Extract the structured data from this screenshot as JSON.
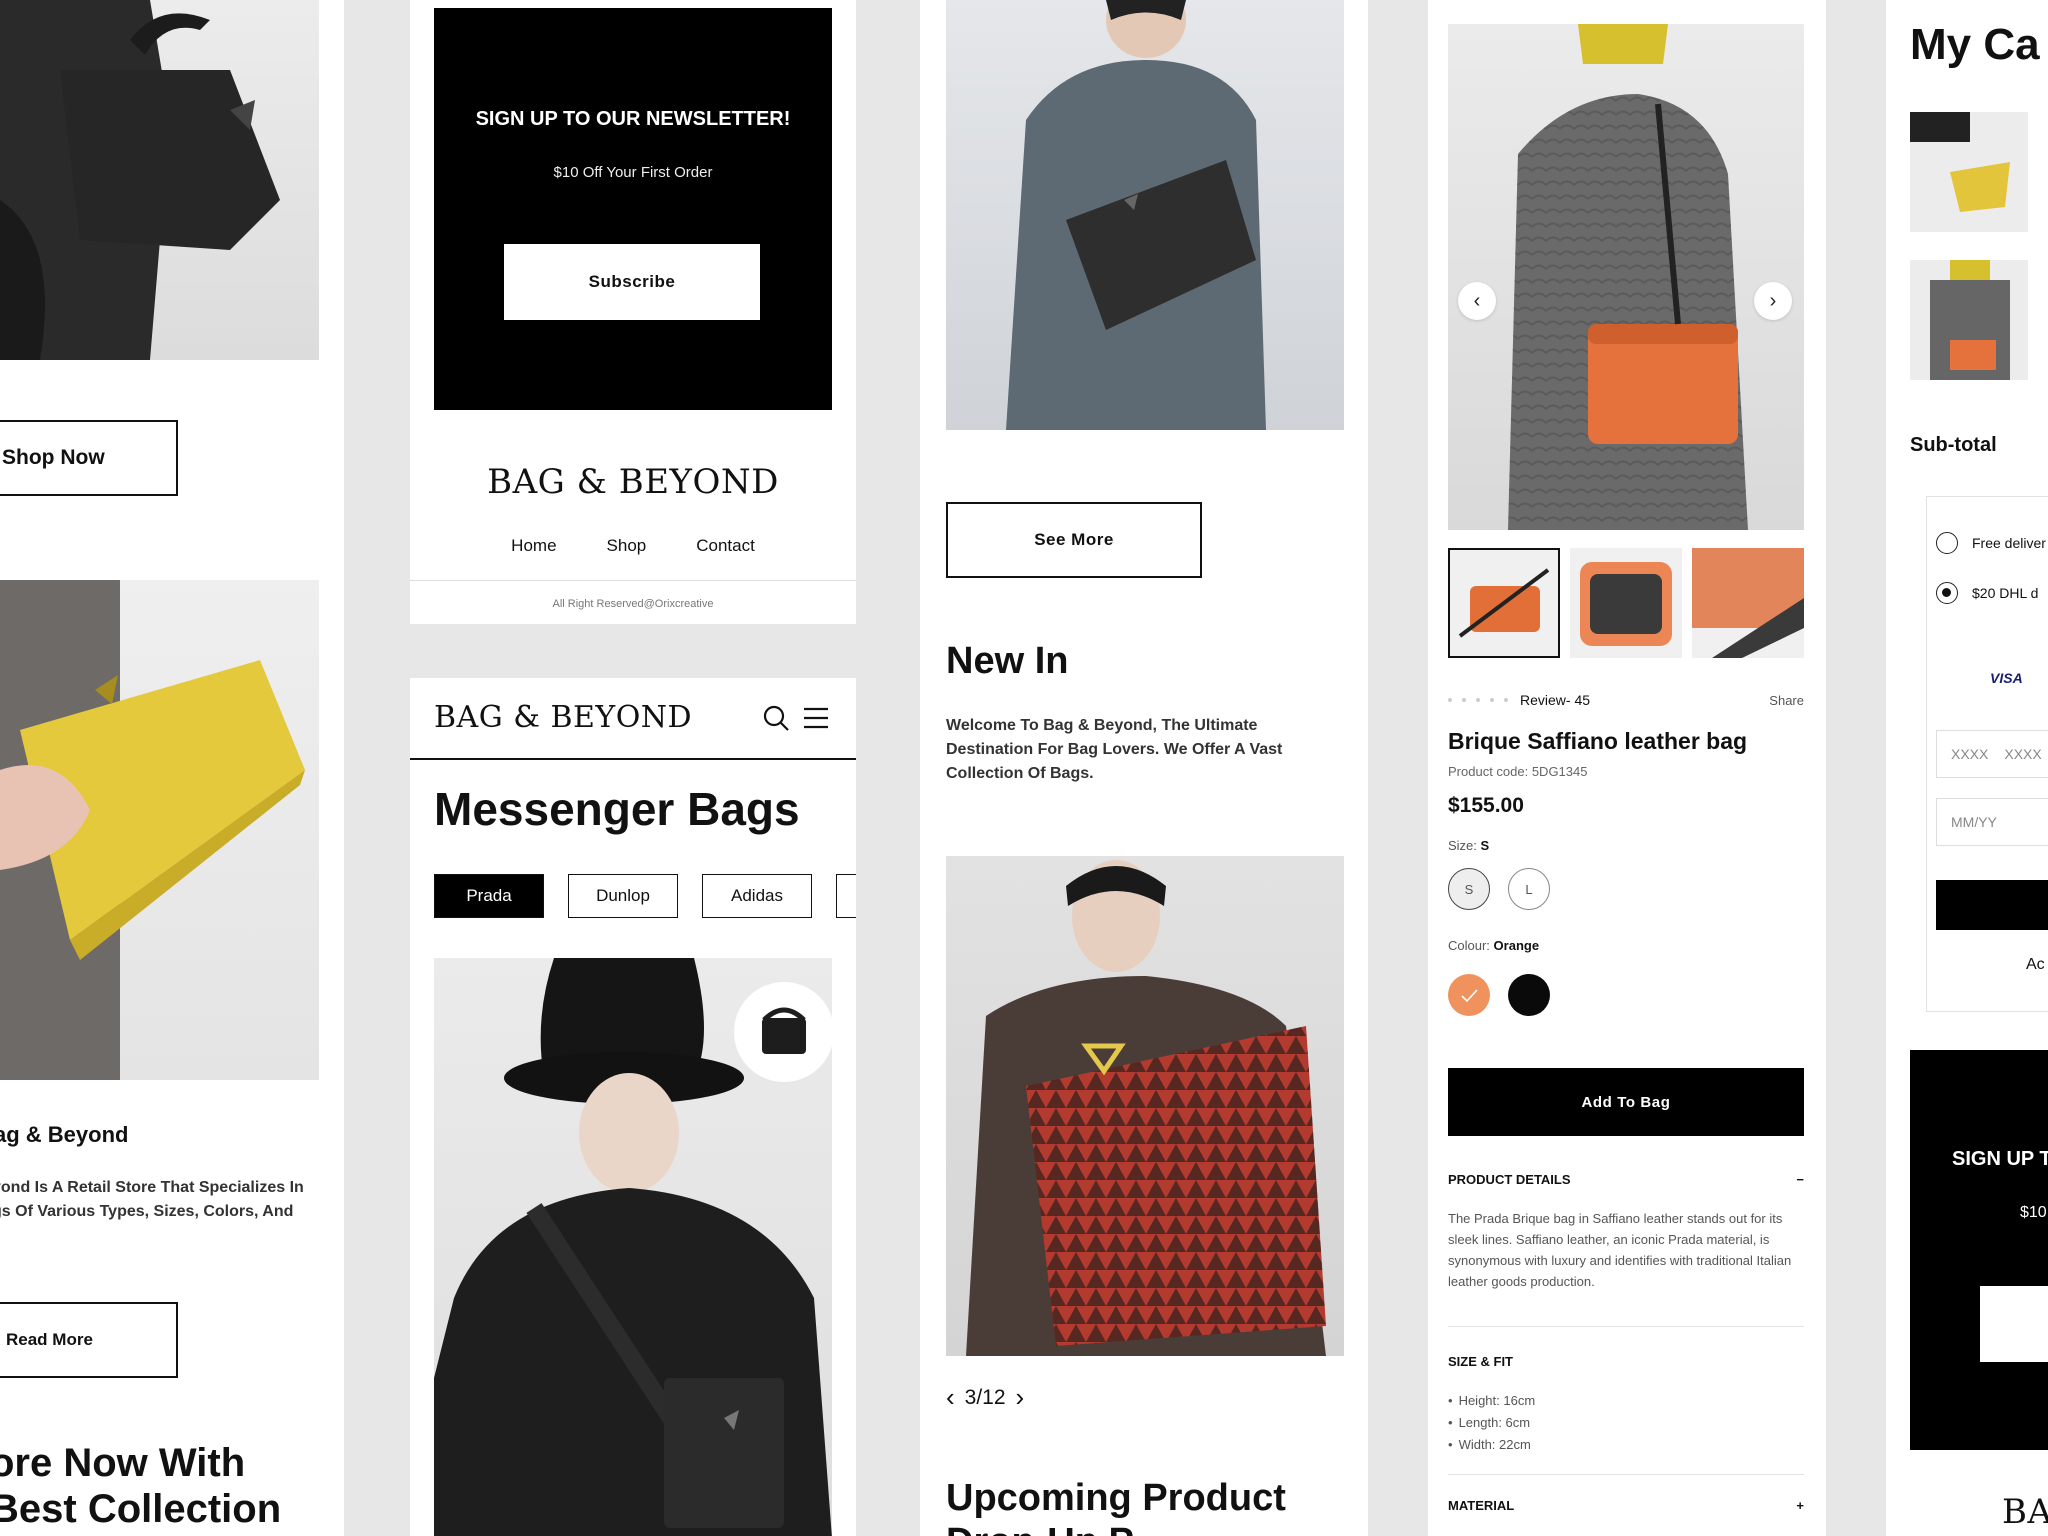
{
  "hero": {
    "shop_now": "Shop Now",
    "about_title": "ag & Beyond",
    "about_text": "yond Is A Retail Store That Specializes In gs Of Various Types, Sizes, Colors, And",
    "read_more": "Read More",
    "explore_title": "ore Now With Best Collection"
  },
  "newsletter": {
    "title": "SIGN UP TO OUR NEWSLETTER!",
    "subtitle": "$10 Off Your First Order",
    "button": "Subscribe"
  },
  "footer": {
    "logo": "BAG & BEYOND",
    "nav": [
      "Home",
      "Shop",
      "Contact"
    ],
    "copyright": "All Right Reserved@Orixcreative"
  },
  "category_page": {
    "logo": "BAG & BEYOND",
    "title": "Messenger Bags",
    "brands": [
      "Prada",
      "Dunlop",
      "Adidas"
    ]
  },
  "home": {
    "see_more": "See More",
    "new_in_title": "New In",
    "new_in_text": "Welcome To Bag & Beyond, The Ultimate Destination For Bag Lovers. We Offer A Vast Collection Of Bags.",
    "pager": "3/12",
    "upcoming_title": "Upcoming Product Drop-Up P"
  },
  "product": {
    "review": "Review- 45",
    "share": "Share",
    "name": "Brique Saffiano leather bag",
    "code": "Product code: 5DG1345",
    "price": "$155.00",
    "size_label": "Size:",
    "size_value": "S",
    "sizes": [
      "S",
      "L"
    ],
    "colour_label": "Colour:",
    "colour_value": "Orange",
    "swatch_colors": [
      "#f0925e",
      "#0a0a0a"
    ],
    "add_to_bag": "Add To Bag",
    "details_title": "PRODUCT DETAILS",
    "details_icon": "minus-icon",
    "details_text": "The Prada Brique bag in Saffiano leather stands out for its sleek lines. Saffiano leather, an iconic Prada material, is synonymous with luxury and identifies with traditional Italian leather goods production.",
    "size_fit_title": "SIZE & FIT",
    "size_fit": [
      "Height: 16cm",
      "Length: 6cm",
      "Width: 22cm"
    ],
    "material_title": "MATERIAL",
    "material_icon": "plus-icon"
  },
  "cart": {
    "title": "My Ca",
    "subtotal": "Sub-total",
    "option1": "Free deliver",
    "option2": "$20 DHL d",
    "card_brand": "VISA",
    "card_number": [
      "XXXX",
      "XXXX"
    ],
    "expiry_placeholder": "MM/YY",
    "note": "Ac",
    "newsletter_title": "SIGN UP T",
    "newsletter_sub": "$10",
    "logo": "BAG"
  },
  "colors": {
    "black": "#000000",
    "accent_orange": "#f0925e"
  }
}
